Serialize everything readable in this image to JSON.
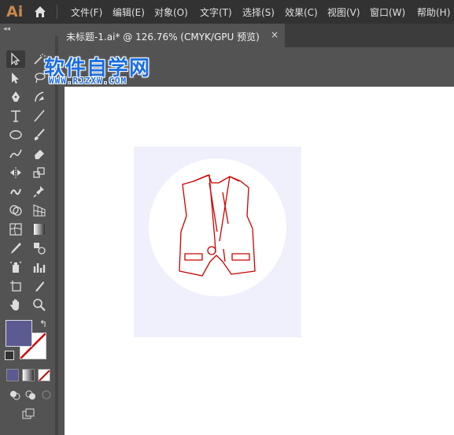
{
  "app": {
    "logo": "Ai"
  },
  "menu": [
    "文件(F)",
    "编辑(E)",
    "对象(O)",
    "文字(T)",
    "选择(S)",
    "效果(C)",
    "视图(V)",
    "窗口(W)",
    "帮助(H)"
  ],
  "document_tab": {
    "title": "未标题-1.ai* @ 126.76% (CMYK/GPU 预览)",
    "close": "×"
  },
  "panel_collapse": "◂◂",
  "watermark": {
    "title": "软件自学网",
    "url": "WWW.RJZXW.COM"
  },
  "colors": {
    "fill": "#5b5a92",
    "stroke_icon": "#cc0000",
    "artwork_bg": "#eff0fb",
    "artboard": "#ffffff"
  },
  "tools": [
    "selection-tool",
    "direct-selection-tool",
    "magic-wand-tool",
    "lasso-tool",
    "pen-tool",
    "curvature-tool",
    "type-tool",
    "line-tool",
    "ellipse-tool",
    "paintbrush-tool",
    "shaper-tool",
    "eraser-tool",
    "reflect-tool",
    "scale-tool",
    "warp-tool",
    "puppet-warp-tool",
    "shape-builder-tool",
    "perspective-grid-tool",
    "mesh-tool",
    "gradient-tool",
    "eyedropper-tool",
    "blend-tool",
    "symbol-sprayer-tool",
    "column-graph-tool",
    "artboard-tool",
    "slice-tool",
    "hand-tool",
    "zoom-tool"
  ]
}
